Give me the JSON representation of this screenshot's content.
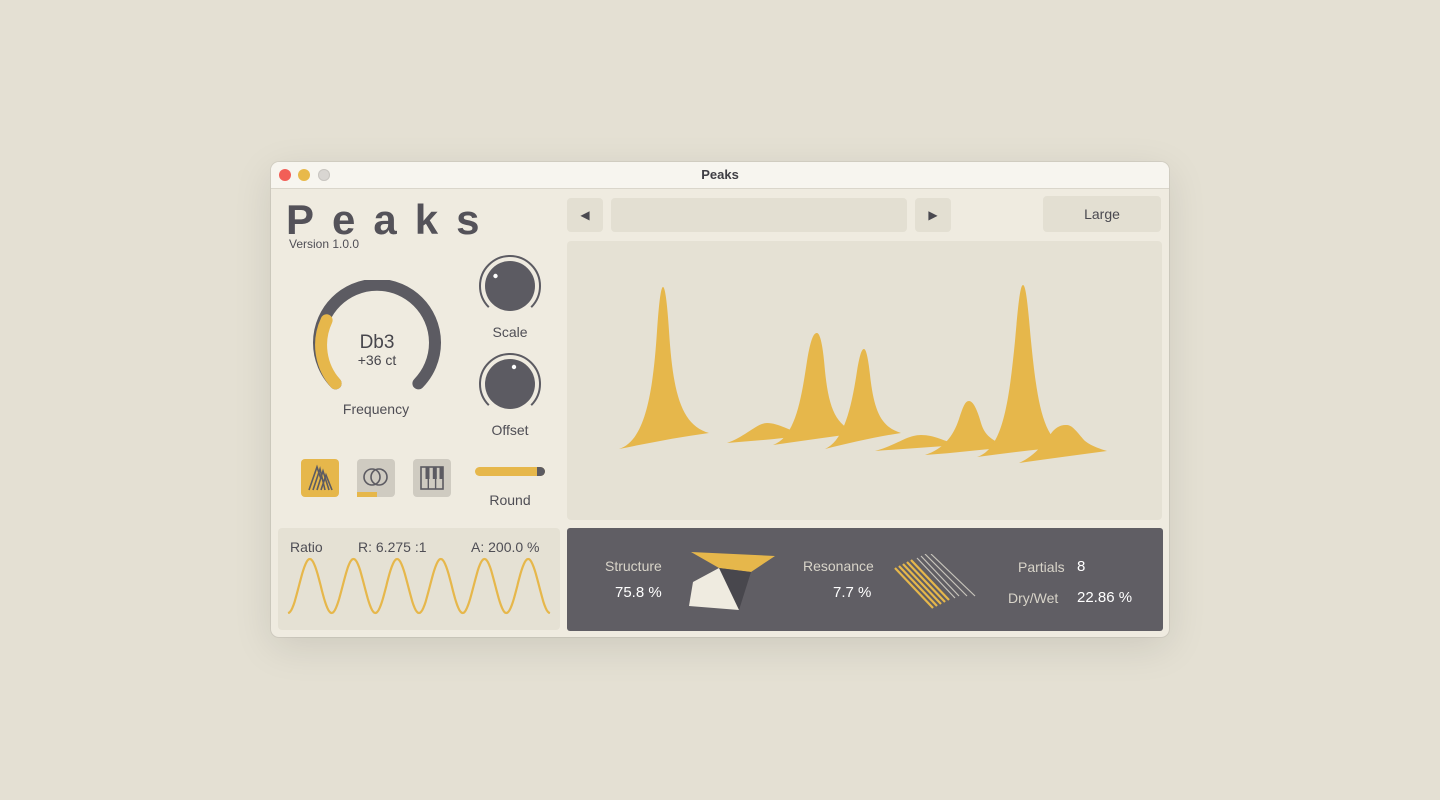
{
  "window": {
    "title": "Peaks"
  },
  "header": {
    "logo": "Peaks",
    "version": "Version 1.0.0"
  },
  "frequency": {
    "note": "Db3",
    "cents": "+36 ct",
    "label": "Frequency",
    "level": 0.32
  },
  "scale": {
    "label": "Scale"
  },
  "offset": {
    "label": "Offset"
  },
  "round": {
    "label": "Round",
    "level": 0.88
  },
  "mode_buttons": [
    {
      "icon": "strings-icon",
      "active": true
    },
    {
      "icon": "rings-icon",
      "active": false
    },
    {
      "icon": "piano-keys-icon",
      "active": false
    }
  ],
  "ratio": {
    "title": "Ratio",
    "r_value": "R: 6.275 :1",
    "a_value": "A: 200.0 %"
  },
  "preset_nav": {
    "prev": "◀",
    "next": "▶",
    "preset_name": "",
    "size": "Large"
  },
  "params": {
    "structure_label": "Structure",
    "structure_value": "75.8 %",
    "resonance_label": "Resonance",
    "resonance_value": "7.7 %",
    "partials_label": "Partials",
    "partials_value": "8",
    "drywet_label": "Dry/Wet",
    "drywet_value": "22.86 %"
  },
  "colors": {
    "accent": "#e6b74b",
    "dark": "#5c5b62",
    "panel": "#605e64",
    "background": "#efebe0"
  }
}
